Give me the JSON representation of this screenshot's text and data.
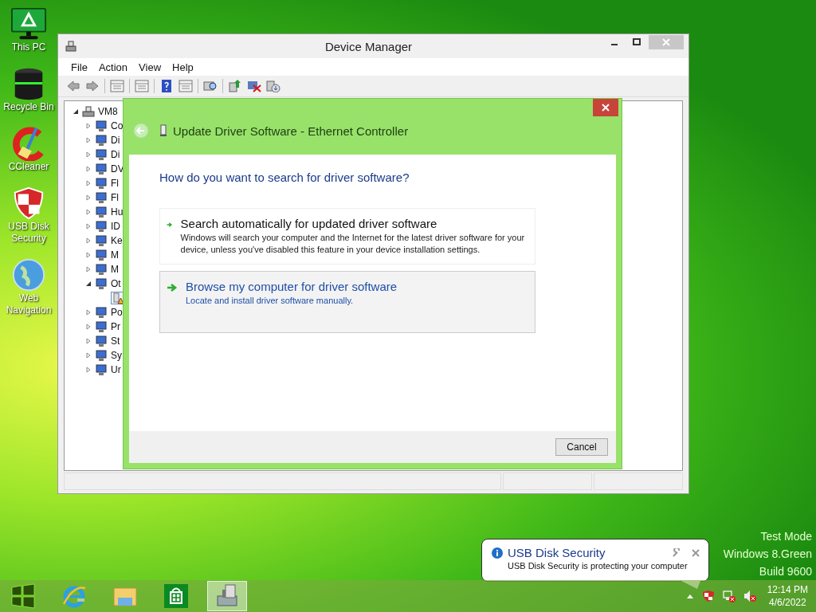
{
  "desktop_icons": [
    {
      "label": "This PC",
      "kind": "monitor"
    },
    {
      "label": "Recycle Bin",
      "kind": "bin"
    },
    {
      "label": "CCleaner",
      "kind": "cleaner"
    },
    {
      "label": "USB Disk Security",
      "kind": "shield"
    },
    {
      "label": "Web Navigation",
      "kind": "globe"
    }
  ],
  "device_manager": {
    "title": "Device Manager",
    "menu": [
      "File",
      "Action",
      "View",
      "Help"
    ],
    "tree": {
      "label": "VM8",
      "expanded": true,
      "children": [
        {
          "label": "Co",
          "expanded": false
        },
        {
          "label": "Di",
          "expanded": false
        },
        {
          "label": "Di",
          "expanded": false
        },
        {
          "label": "DV",
          "expanded": false
        },
        {
          "label": "Fl",
          "expanded": false
        },
        {
          "label": "Fl",
          "expanded": false
        },
        {
          "label": "Hu",
          "expanded": false
        },
        {
          "label": "ID",
          "expanded": false
        },
        {
          "label": "Ke",
          "expanded": false
        },
        {
          "label": "M",
          "expanded": false
        },
        {
          "label": "M",
          "expanded": false
        },
        {
          "label": "Ot",
          "expanded": true,
          "children": [
            {
              "warning": true
            }
          ]
        },
        {
          "label": "Po",
          "expanded": false
        },
        {
          "label": "Pr",
          "expanded": false
        },
        {
          "label": "St",
          "expanded": false
        },
        {
          "label": "Sy",
          "expanded": false
        },
        {
          "label": "Ur",
          "expanded": false
        }
      ]
    }
  },
  "dialog": {
    "title": "Update Driver Software - Ethernet Controller",
    "question": "How do you want to search for driver software?",
    "options": [
      {
        "title": "Search automatically for updated driver software",
        "description": "Windows will search your computer and the Internet for the latest driver software for your device, unless you've disabled this feature in your device installation settings.",
        "selected": false
      },
      {
        "title": "Browse my computer for driver software",
        "description": "Locate and install driver software manually.",
        "selected": true
      }
    ],
    "buttons": [
      "Cancel"
    ]
  },
  "desktop_info": [
    "Test Mode",
    "Windows 8.Green",
    "Build 9600"
  ],
  "notification": {
    "title": "USB Disk Security",
    "message": "USB Disk Security is protecting your computer"
  },
  "taskbar": {
    "items": [
      {
        "kind": "start",
        "selected": false
      },
      {
        "kind": "browser",
        "selected": false
      },
      {
        "kind": "folder",
        "selected": false
      },
      {
        "kind": "store",
        "selected": false
      },
      {
        "kind": "devices",
        "selected": true
      }
    ],
    "clock": {
      "time": "12:14 PM",
      "date": "4/6/2022"
    }
  }
}
